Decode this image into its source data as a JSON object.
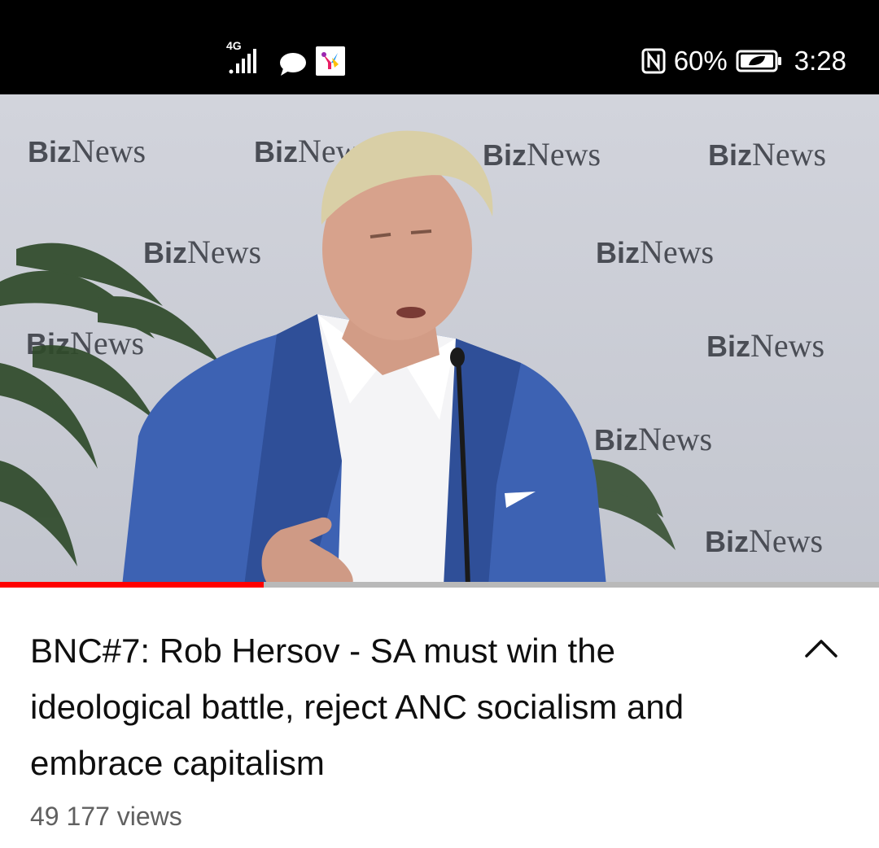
{
  "status_bar": {
    "network": "4G",
    "battery_percent": "60%",
    "time": "3:28",
    "icons": [
      "signal-icon",
      "chat-bubble-icon",
      "app-notification-icon",
      "nfc-icon",
      "battery-saver-icon"
    ]
  },
  "video": {
    "backdrop_brand": "BizNews",
    "progress_fraction": 0.3,
    "progress_color": "#ff0000"
  },
  "details": {
    "title": "BNC#7: Rob Hersov - SA must win the ideological battle, reject ANC socialism and embrace capitalism",
    "views": "49 177 views",
    "collapse_icon": "chevron-up-icon"
  }
}
